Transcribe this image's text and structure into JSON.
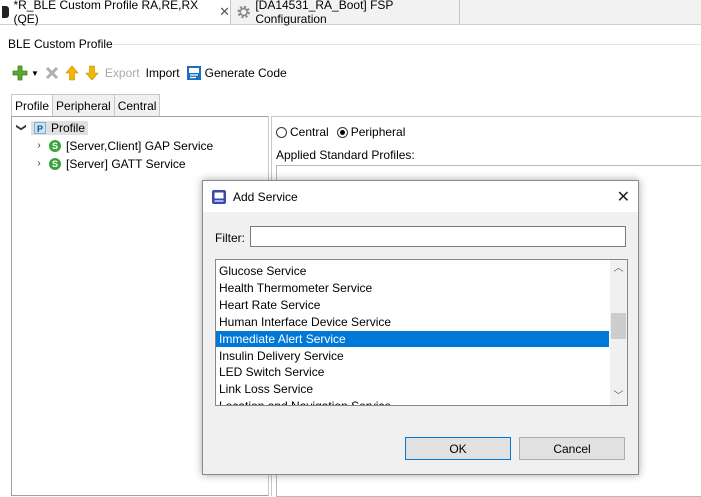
{
  "tabs": [
    {
      "label": "*R_BLE Custom Profile RA,RE,RX (QE)",
      "close_glyph": "✕",
      "icon": "dark-tab-icon"
    },
    {
      "label": "[DA14531_RA_Boot] FSP Configuration",
      "icon": "gear-icon"
    }
  ],
  "editor_title": "BLE Custom Profile",
  "toolbar": {
    "export_label": "Export",
    "import_label": "Import",
    "generate_label": "Generate Code"
  },
  "profile_tabs": [
    "Profile",
    "Peripheral",
    "Central"
  ],
  "tree": {
    "root": {
      "badge": "P",
      "label": "Profile"
    },
    "children": [
      {
        "badge": "S",
        "label": "[Server,Client] GAP Service"
      },
      {
        "badge": "S",
        "label": "[Server] GATT Service"
      }
    ]
  },
  "right_pane": {
    "radio_central": "Central",
    "radio_peripheral": "Peripheral",
    "selected_role": "Peripheral",
    "applied_label": "Applied Standard Profiles:"
  },
  "dialog": {
    "title": "Add Service",
    "close_glyph": "✕",
    "filter_label": "Filter:",
    "filter_value": "",
    "items": [
      "Glucose Service",
      "Health Thermometer Service",
      "Heart Rate Service",
      "Human Interface Device Service",
      "Immediate Alert Service",
      "Insulin Delivery Service",
      "LED Switch Service",
      "Link Loss Service",
      "Location and Navigation Service"
    ],
    "selected_item": "Immediate Alert Service",
    "scroll_position": 0.42,
    "ok_label": "OK",
    "cancel_label": "Cancel"
  },
  "colors": {
    "selection": "#0078d7",
    "service_badge": "#3aa43a",
    "add_icon": "#5aa832",
    "up_arrow": "#f2b600"
  }
}
